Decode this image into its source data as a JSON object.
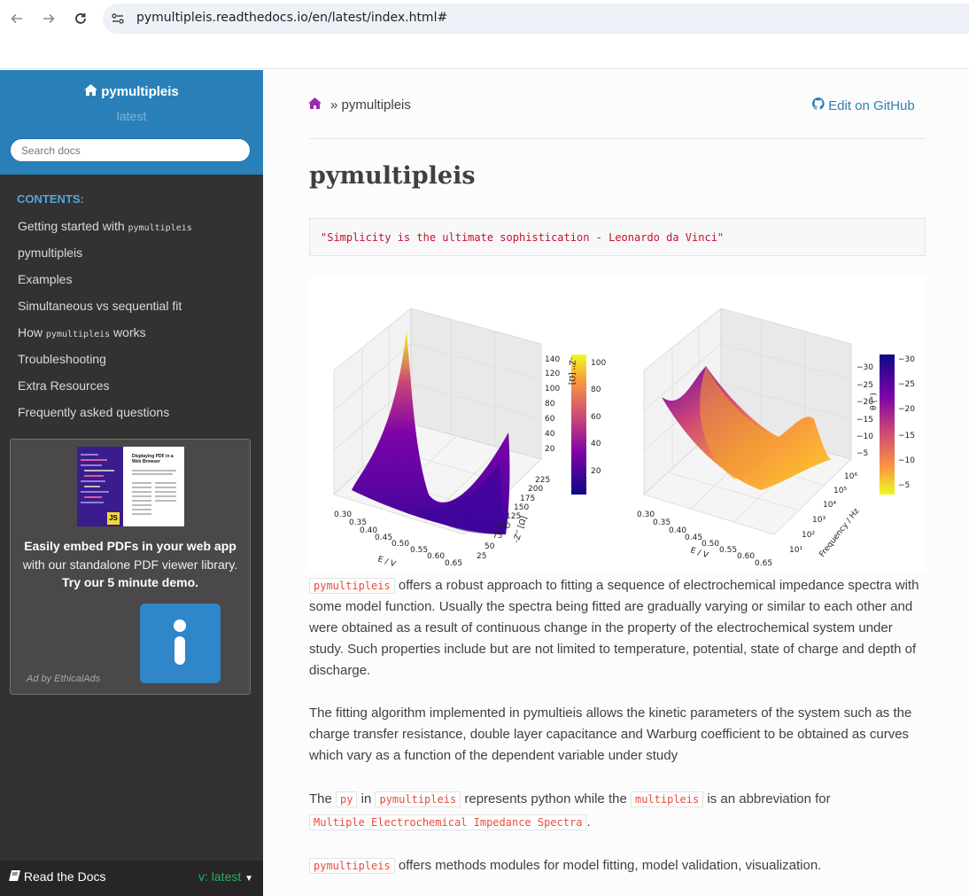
{
  "browser": {
    "url": "pymultipleis.readthedocs.io/en/latest/index.html#",
    "back_icon": "arrow-left-icon",
    "forward_icon": "arrow-right-icon",
    "reload_icon": "reload-icon"
  },
  "sidebar": {
    "project_name": "pymultipleis",
    "version": "latest",
    "search_placeholder": "Search docs",
    "caption": "CONTENTS:",
    "items": [
      {
        "label": "Getting started with ",
        "code": "pymultipleis"
      },
      {
        "label": "pymultipleis",
        "code": ""
      },
      {
        "label": "Examples",
        "code": ""
      },
      {
        "label": "Simultaneous vs sequential fit",
        "code": ""
      },
      {
        "label": "How ",
        "code": "pymultipleis",
        "suffix": " works"
      },
      {
        "label": "Troubleshooting",
        "code": ""
      },
      {
        "label": "Extra Resources",
        "code": ""
      },
      {
        "label": "Frequently asked questions",
        "code": ""
      }
    ],
    "ad": {
      "thumb_title": "Displaying PDF in a Web Browser",
      "thumb_badge": "JS",
      "headline": "Easily embed PDFs in your web app",
      "body": "with our standalone PDF viewer library.",
      "cta": "Try our 5 minute demo.",
      "by": "Ad by EthicalAds"
    },
    "footer": {
      "brand": "Read the Docs",
      "version": "v: latest"
    }
  },
  "content": {
    "breadcrumb": "» pymultipleis",
    "edit_link": "Edit on GitHub",
    "title": "pymultipleis",
    "quote": "\"Simplicity is the ultimate sophistication - Leonardo da Vinci\"",
    "figure": {
      "left_xlabel": "E / V",
      "left_ylabel": "-Z'' [Ω]",
      "left_zlabel": "-Z'' [Ω]",
      "left_xticks": [
        "0.30",
        "0.35",
        "0.40",
        "0.45",
        "0.50",
        "0.55",
        "0.60",
        "0.65"
      ],
      "left_yticks": [
        "25",
        "50",
        "75",
        "100",
        "125",
        "150",
        "175",
        "200",
        "225"
      ],
      "left_zticks": [
        "20",
        "40",
        "60",
        "80",
        "100",
        "120",
        "140"
      ],
      "left_cbar_ticks": [
        "20",
        "40",
        "60",
        "80",
        "100"
      ],
      "right_xlabel": "E / V",
      "right_ylabel": "Frequency / Hz",
      "right_zlabel": "θ (°)",
      "right_xticks": [
        "0.30",
        "0.35",
        "0.40",
        "0.45",
        "0.50",
        "0.55",
        "0.60",
        "0.65"
      ],
      "right_yticks": [
        "10¹",
        "10²",
        "10³",
        "10⁴",
        "10⁵",
        "10⁶"
      ],
      "right_zticks": [
        "−5",
        "−10",
        "−15",
        "−20",
        "−25",
        "−30"
      ],
      "right_cbar_ticks": [
        "−5",
        "−10",
        "−15",
        "−20",
        "−25",
        "−30"
      ]
    },
    "p1_code": "pymultipleis",
    "p1_text": " offers a robust approach to fitting a sequence of electrochemical impedance spectra with some model function. Usually the spectra being fitted are gradually varying or similar to each other and were obtained as a result of continuous change in the property of the electrochemical system under study. Such properties include but are not limited to temperature, potential, state of charge and depth of discharge.",
    "p2_text": "The fitting algorithm implemented in pymultieis allows the kinetic parameters of the system such as the charge transfer resistance, double layer capacitance and Warburg coefficient to be obtained as curves which vary as a function of the dependent variable under study",
    "p3_a": "The ",
    "p3_code1": "py",
    "p3_b": " in ",
    "p3_code2": "pymultipleis",
    "p3_c": " represents python while the ",
    "p3_code3": "multipleis",
    "p3_d": " is an abbreviation for",
    "p3_code4": "Multiple Electrochemical Impedance Spectra",
    "p3_e": ".",
    "p4_code": "pymultipleis",
    "p4_text": " offers methods modules for model fitting, model validation, visualization."
  }
}
